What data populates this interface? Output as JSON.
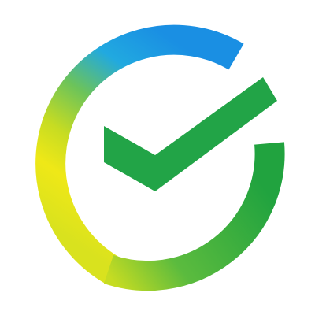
{
  "logo": {
    "name": "ring-checkmark-logo",
    "icon": "checkmark-ring-icon",
    "colors": {
      "background": "#ffffff",
      "ring_gradient": [
        "#1aa0e8",
        "#2fb3d6",
        "#5ec06a",
        "#b9d92c",
        "#f0e91a",
        "#c8dd23",
        "#3ab54a",
        "#1fa83c"
      ],
      "check": "#22a447"
    }
  }
}
